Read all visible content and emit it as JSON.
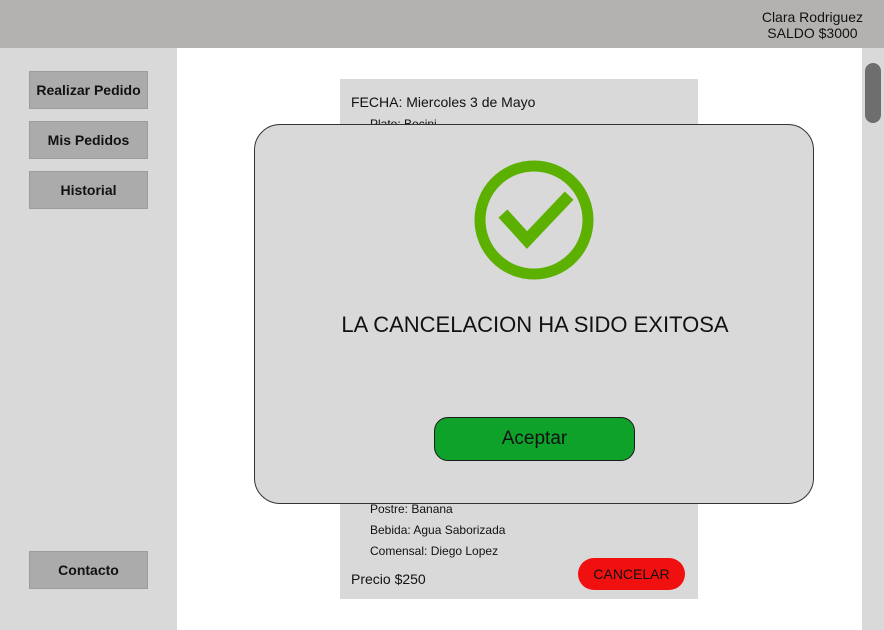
{
  "header": {
    "user_name": "Clara Rodriguez",
    "balance": "SALDO $3000"
  },
  "sidebar": {
    "items": [
      {
        "label": "Realizar Pedido"
      },
      {
        "label": "Mis Pedidos"
      },
      {
        "label": "Historial"
      }
    ],
    "contact_label": "Contacto"
  },
  "order": {
    "date": "FECHA:  Miercoles 3 de Mayo",
    "plate_partial": "Plato: Bocini...",
    "dessert": "Postre: Banana",
    "drink": "Bebida: Agua Saborizada",
    "diner": "Comensal: Diego Lopez",
    "price": "Precio $250",
    "cancel_label": "CANCELAR"
  },
  "modal": {
    "message": "LA CANCELACION HA SIDO EXITOSA",
    "accept_label": "Aceptar",
    "icon": "check-circle-icon",
    "accent_color": "#5cb000"
  },
  "colors": {
    "accept": "#0ea22a",
    "cancel": "#f01010"
  }
}
